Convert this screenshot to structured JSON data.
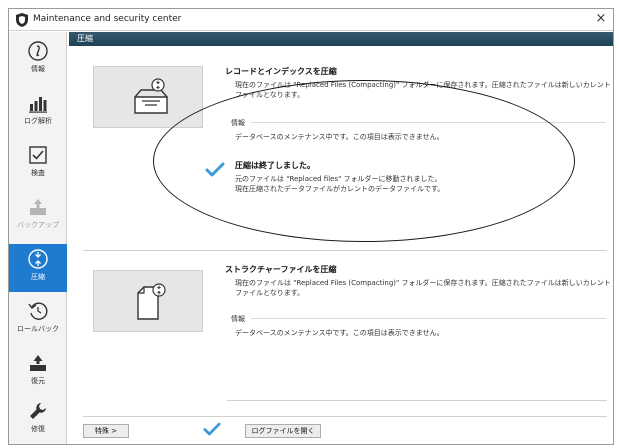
{
  "window": {
    "title": "Maintenance and security center",
    "close_glyph": "×"
  },
  "sidebar": {
    "items": [
      {
        "label": "情報",
        "icon": "info-icon",
        "state": "normal"
      },
      {
        "label": "ログ解析",
        "icon": "bar-chart-icon",
        "state": "normal"
      },
      {
        "label": "検査",
        "icon": "checkbox-icon",
        "state": "normal"
      },
      {
        "label": "バックアップ",
        "icon": "backup-icon",
        "state": "disabled"
      },
      {
        "label": "圧縮",
        "icon": "compress-icon",
        "state": "active"
      },
      {
        "label": "ロールバック",
        "icon": "rollback-icon",
        "state": "normal"
      },
      {
        "label": "復元",
        "icon": "restore-icon",
        "state": "normal"
      },
      {
        "label": "修復",
        "icon": "wrench-icon",
        "state": "normal"
      }
    ]
  },
  "header": {
    "title": "圧縮"
  },
  "section1": {
    "title": "レコードとインデックスを圧縮",
    "desc": "現在のファイルは \"Replaced Files (Compacting)\" フォルダーに保存されます。圧縮されたファイルは新しいカレントファイルとなります。",
    "info_label": "情報",
    "info_text": "データベースのメンテナンス中です。この項目は表示できません。",
    "done_title": "圧縮は終了しました。",
    "done_line1": "元のファイルは \"Replaced files\" フォルダーに移動されました。",
    "done_line2": "現在圧縮されたデータファイルがカレントのデータファイルです。"
  },
  "section2": {
    "title": "ストラクチャーファイルを圧縮",
    "desc": "現在のファイルは \"Replaced Files (Compacting)\" フォルダーに保存されます。圧縮されたファイルは新しいカレントファイルとなります。",
    "info_label": "情報",
    "info_text": "データベースのメンテナンス中です。この項目は表示できません。"
  },
  "footer": {
    "special_button": "特殊 >",
    "open_log_button": "ログファイルを開く"
  },
  "colors": {
    "accent": "#1e7bd0",
    "header": "#2a4d62",
    "check": "#3d9ad8"
  }
}
